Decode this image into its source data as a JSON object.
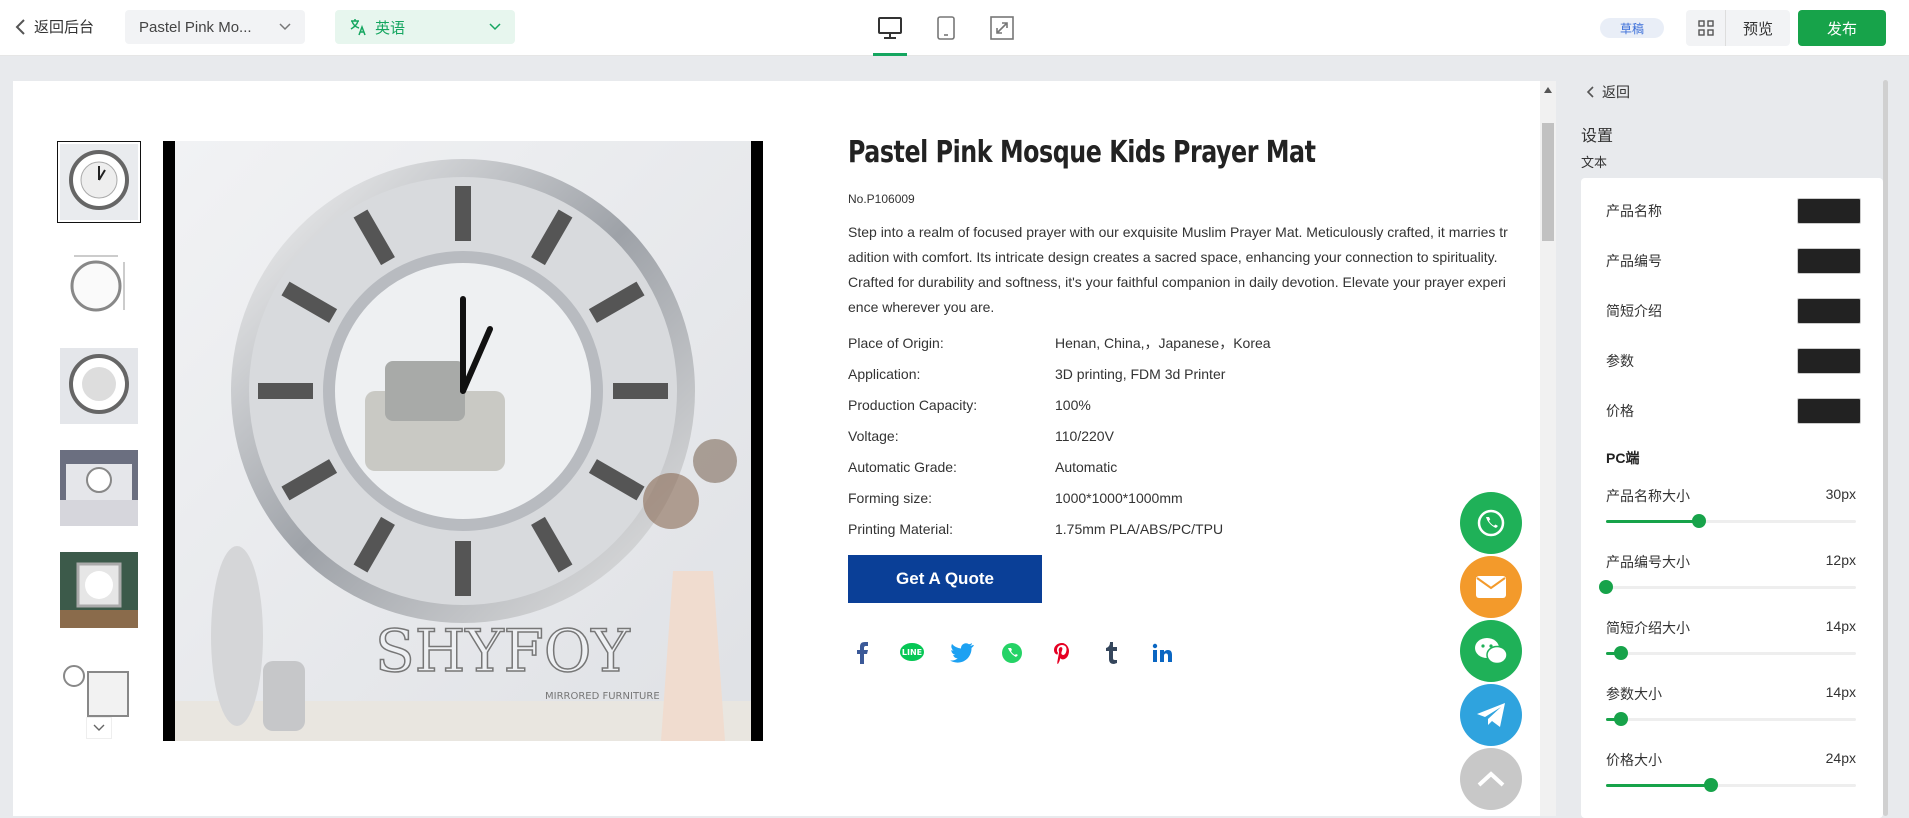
{
  "topbar": {
    "back_label": "返回后台",
    "page_select": "Pastel Pink Mo...",
    "language_select": "英语",
    "status_badge": "草稿",
    "preview_label": "预览",
    "publish_label": "发布",
    "devices": [
      "desktop-icon",
      "tablet-icon",
      "fullscreen-icon"
    ],
    "active_device": "desktop",
    "accent_color": "#17a34a"
  },
  "product": {
    "title": "Pastel Pink Mosque Kids Prayer Mat",
    "number": "No.P106009",
    "description": "Step into a realm of focused prayer with our exquisite Muslim Prayer Mat. Meticulously crafted, it marries tradition with comfort. Its intricate design creates a sacred space, enhancing your connection to spirituality. Crafted for durability and softness, it's your faithful companion in daily devotion. Elevate your prayer experience wherever you are.",
    "params": [
      {
        "key": "Place of Origin:",
        "value": "Henan, China,，Japanese，Korea"
      },
      {
        "key": "Application:",
        "value": "3D printing, FDM 3d Printer"
      },
      {
        "key": "Production Capacity:",
        "value": "100%"
      },
      {
        "key": "Voltage:",
        "value": "110/220V"
      },
      {
        "key": "Automatic Grade:",
        "value": "Automatic"
      },
      {
        "key": "Forming size:",
        "value": "1000*1000*1000mm"
      },
      {
        "key": "Printing Material:",
        "value": "1.75mm PLA/ABS/PC/TPU"
      }
    ],
    "quote_label": "Get A Quote",
    "brand_watermark": "SHYFOY",
    "brand_sub": "MIRRORED FURNITURE",
    "social": [
      "facebook-icon",
      "line-icon",
      "twitter-icon",
      "whatsapp-icon",
      "pinterest-icon",
      "tumblr-icon",
      "linkedin-icon"
    ],
    "quote_color": "#0a3f97"
  },
  "floating": [
    "whatsapp-icon",
    "mail-icon",
    "wechat-icon",
    "telegram-icon",
    "back-to-top-icon"
  ],
  "panel": {
    "back_label": "返回",
    "heading": "设置",
    "subheading": "文本",
    "colors": [
      {
        "label": "产品名称",
        "color": "#222222"
      },
      {
        "label": "产品编号",
        "color": "#222222"
      },
      {
        "label": "简短介绍",
        "color": "#222222"
      },
      {
        "label": "参数",
        "color": "#222222"
      },
      {
        "label": "价格",
        "color": "#222222"
      }
    ],
    "pc_heading": "PC端",
    "sliders": [
      {
        "label": "产品名称大小",
        "value": "30px",
        "level": 0.37
      },
      {
        "label": "产品编号大小",
        "value": "12px",
        "level": 0.0
      },
      {
        "label": "简短介绍大小",
        "value": "14px",
        "level": 0.06
      },
      {
        "label": "参数大小",
        "value": "14px",
        "level": 0.06
      },
      {
        "label": "价格大小",
        "value": "24px",
        "level": 0.42
      }
    ]
  }
}
